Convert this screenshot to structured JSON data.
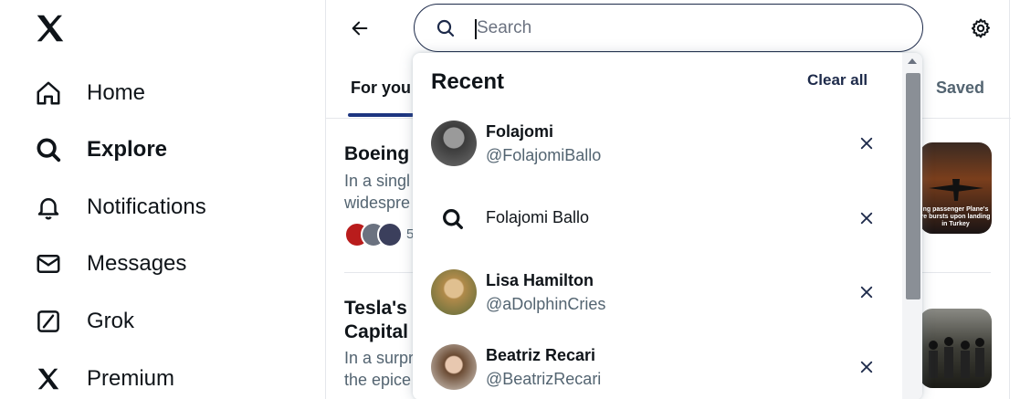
{
  "nav": {
    "logo": "x-logo-icon",
    "items": [
      {
        "label": "Home",
        "icon": "home-icon",
        "active": false
      },
      {
        "label": "Explore",
        "icon": "search-icon",
        "active": true
      },
      {
        "label": "Notifications",
        "icon": "bell-icon",
        "active": false
      },
      {
        "label": "Messages",
        "icon": "envelope-icon",
        "active": false
      },
      {
        "label": "Grok",
        "icon": "grok-icon",
        "active": false
      },
      {
        "label": "Premium",
        "icon": "x-logo-icon",
        "active": false
      }
    ]
  },
  "search": {
    "placeholder": "Search",
    "value": ""
  },
  "tabs": {
    "for_you": "For you",
    "saved": "Saved"
  },
  "stories": [
    {
      "title": "Boeing",
      "desc_1": "In a singl",
      "desc_2": "widespre",
      "count_partial": "5",
      "image_caption": "ng passenger Plane's re bursts upon landing in Turkey"
    },
    {
      "title_1": "Tesla's",
      "title_2": "Capital",
      "desc_1": "In a surpr",
      "desc_2": "the epice"
    }
  ],
  "dropdown": {
    "heading": "Recent",
    "clear_all": "Clear all",
    "items": [
      {
        "type": "user",
        "name": "Folajomi",
        "handle": "@FolajomiBallo"
      },
      {
        "type": "query",
        "query": "Folajomi Ballo"
      },
      {
        "type": "user",
        "name": "Lisa Hamilton",
        "handle": "@aDolphinCries"
      },
      {
        "type": "user",
        "name": "Beatriz Recari",
        "handle": "@BeatrizRecari"
      }
    ]
  },
  "colors": {
    "accent": "#1d3580",
    "text": "#0f1419",
    "muted": "#536471"
  }
}
